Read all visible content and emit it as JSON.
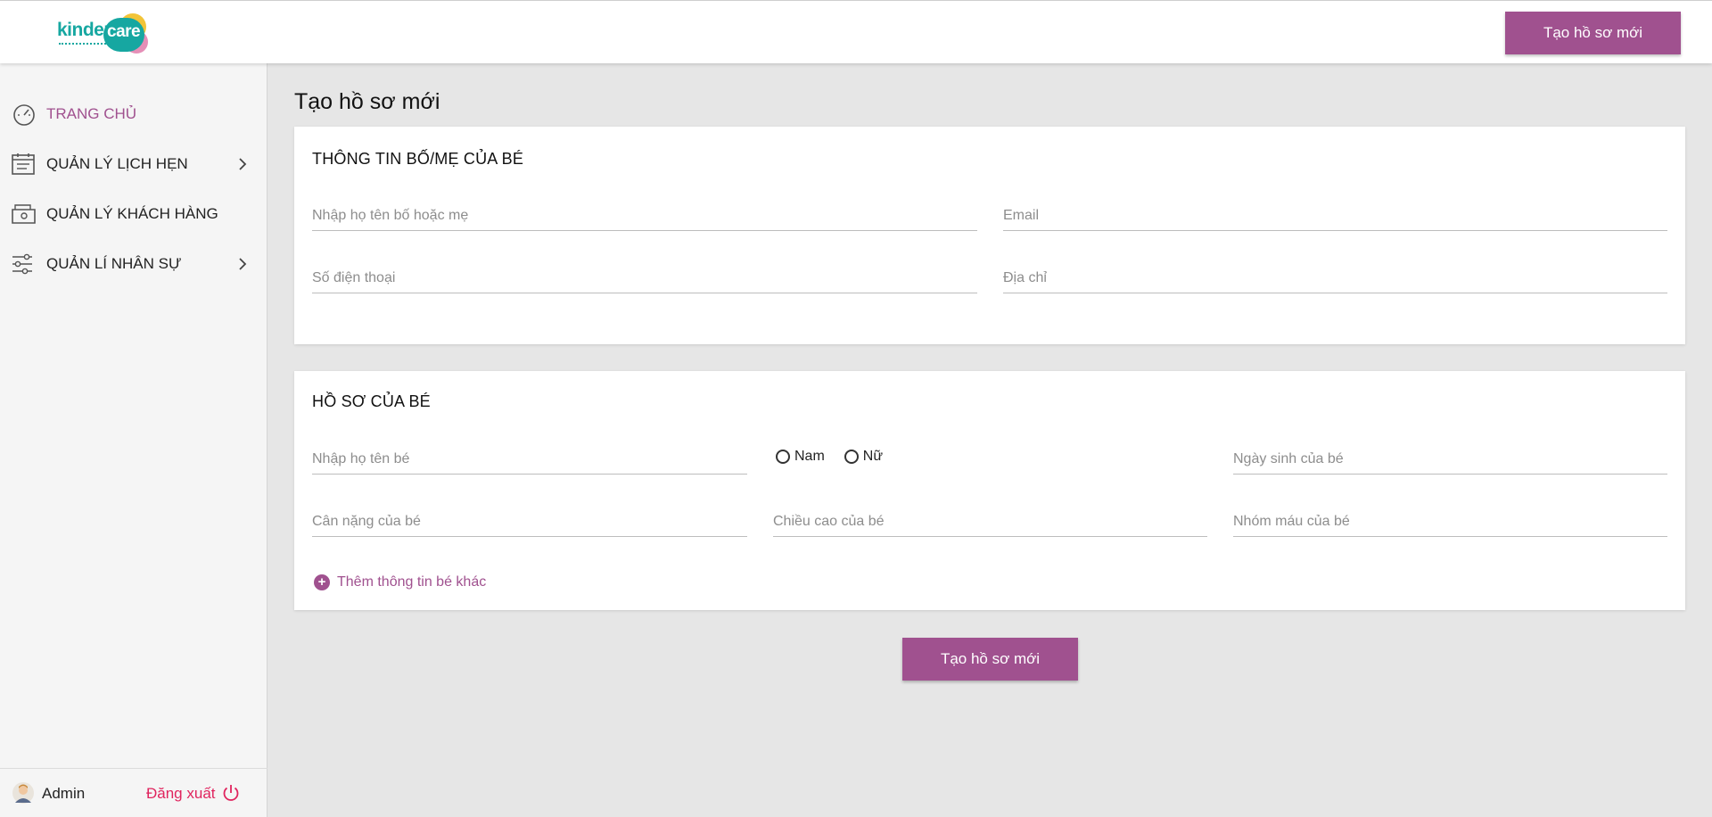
{
  "brand": {
    "logo_text_1": "kinder",
    "logo_text_2": "care",
    "accent_color": "#a0518f",
    "teal_color": "#16a7a1"
  },
  "header": {
    "create_button_label": "Tạo hồ sơ mới"
  },
  "sidebar": {
    "items": [
      {
        "label": "TRANG CHỦ",
        "icon": "speedometer-icon",
        "active": true,
        "has_submenu": false
      },
      {
        "label": "QUẢN LÝ LỊCH HẸN",
        "icon": "calendar-list-icon",
        "active": false,
        "has_submenu": true
      },
      {
        "label": "QUẢN LÝ KHÁCH HÀNG",
        "icon": "folder-icon",
        "active": false,
        "has_submenu": false
      },
      {
        "label": "QUẢN LÍ NHÂN SỰ",
        "icon": "sliders-icon",
        "active": false,
        "has_submenu": true
      }
    ],
    "footer": {
      "user_name": "Admin",
      "logout_label": "Đăng xuất"
    }
  },
  "main": {
    "page_title": "Tạo hồ sơ mới",
    "parent_section": {
      "title": "THÔNG TIN BỐ/MẸ CỦA BÉ",
      "fields": {
        "parent_name": {
          "placeholder": "Nhập họ tên bố hoặc mẹ",
          "value": ""
        },
        "email": {
          "placeholder": "Email",
          "value": ""
        },
        "phone": {
          "placeholder": "Số điện thoại",
          "value": ""
        },
        "address": {
          "placeholder": "Địa chỉ",
          "value": ""
        }
      }
    },
    "child_section": {
      "title": "HỒ SƠ CỦA BÉ",
      "fields": {
        "child_name": {
          "placeholder": "Nhập họ tên bé",
          "value": ""
        },
        "birth_date": {
          "placeholder": "Ngày sinh của bé",
          "value": ""
        },
        "weight": {
          "placeholder": "Cân nặng của bé",
          "value": ""
        },
        "height": {
          "placeholder": "Chiều cao của bé",
          "value": ""
        },
        "blood_type": {
          "placeholder": "Nhóm máu của bé",
          "value": ""
        }
      },
      "gender_options": [
        "Nam",
        "Nữ"
      ],
      "add_more_label": "Thêm thông tin bé khác"
    },
    "submit_label": "Tạo hồ sơ mới"
  }
}
